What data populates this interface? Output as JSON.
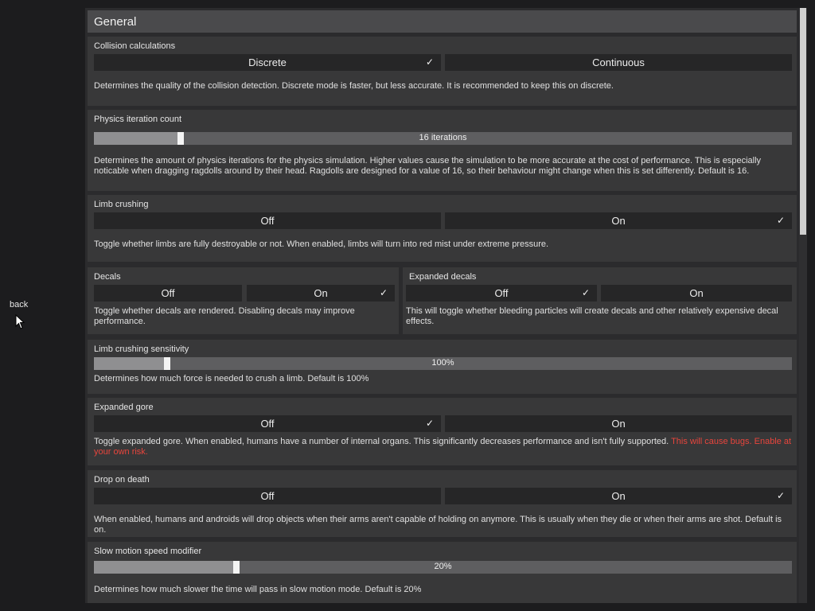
{
  "back_label": "back",
  "header_title": "General",
  "collision": {
    "title": "Collision calculations",
    "opt1": "Discrete",
    "opt2": "Continuous",
    "check": "✓",
    "desc": "Determines the quality of the collision detection. Discrete mode is faster, but less accurate. It is recommended to keep this on discrete."
  },
  "iterations": {
    "title": "Physics iteration count",
    "value_label": "16 iterations",
    "fraction": 0.12,
    "desc": "Determines the amount of physics iterations for the physics simulation. Higher values cause the simulation to be more accurate at the cost of performance. This is especially noticable when dragging ragdolls around by their head. Ragdolls are designed for a value of 16, so their behaviour might change when this is set differently. Default is 16."
  },
  "limb_crushing": {
    "title": "Limb crushing",
    "opt1": "Off",
    "opt2": "On",
    "check": "✓",
    "desc": "Toggle whether limbs are fully destroyable or not. When enabled, limbs will turn into red mist under extreme pressure."
  },
  "decals": {
    "title": "Decals",
    "opt1": "Off",
    "opt2": "On",
    "check": "✓",
    "desc": "Toggle whether decals are rendered. Disabling decals may improve performance."
  },
  "expanded_decals": {
    "title": "Expanded decals",
    "opt1": "Off",
    "opt2": "On",
    "check": "✓",
    "desc": "This will toggle whether bleeding particles will create decals and other relatively expensive decal effects."
  },
  "crush_sensitivity": {
    "title": "Limb crushing sensitivity",
    "value_label": "100%",
    "fraction": 0.1,
    "desc": "Determines how much force is needed to crush a limb. Default is 100%"
  },
  "expanded_gore": {
    "title": "Expanded gore",
    "opt1": "Off",
    "opt2": "On",
    "check": "✓",
    "desc": "Toggle expanded gore. When enabled, humans have a number of internal organs. This significantly decreases performance and isn't fully supported.",
    "warning": "This will cause bugs. Enable at your own risk."
  },
  "drop_on_death": {
    "title": "Drop on death",
    "opt1": "Off",
    "opt2": "On",
    "check": "✓",
    "desc": "When enabled, humans and androids will drop objects when their arms aren't capable of holding on anymore. This is usually when they die or when their arms are shot. Default is on."
  },
  "slowmo": {
    "title": "Slow motion speed modifier",
    "value_label": "20%",
    "fraction": 0.2,
    "desc": "Determines how much slower the time will pass in slow motion mode. Default is 20%"
  },
  "colors": {
    "panel": "#2b2b2d",
    "section": "#383839",
    "button": "#262627",
    "warning": "#e8453c"
  },
  "icons": [
    "checkmark-icon",
    "mouse-cursor-icon"
  ]
}
